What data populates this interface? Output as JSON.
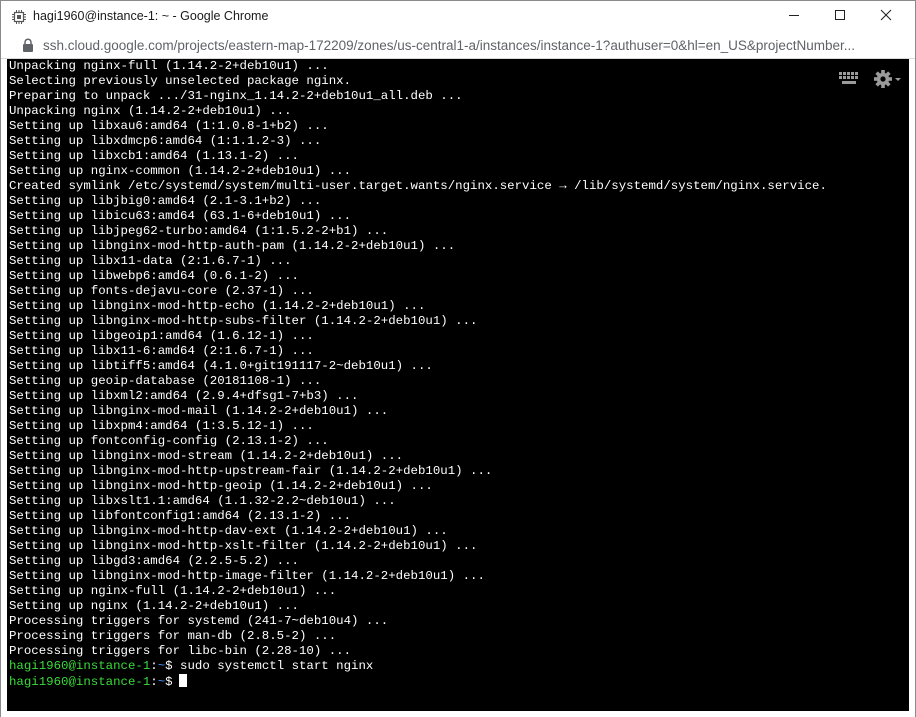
{
  "window": {
    "title": "hagi1960@instance-1: ~ - Google Chrome",
    "controls": {
      "minimize": "minimize",
      "maximize": "maximize",
      "close": "close"
    }
  },
  "address": {
    "url_host": "ssh.cloud.google.com",
    "url_rest": "/projects/eastern-map-172209/zones/us-central1-a/instances/instance-1?authuser=0&hl=en_US&projectNumber..."
  },
  "terminal": {
    "toolbar_icons": [
      "keyboard-icon",
      "gear-icon"
    ],
    "lines": [
      "Unpacking nginx-full (1.14.2-2+deb10u1) ...",
      "Selecting previously unselected package nginx.",
      "Preparing to unpack .../31-nginx_1.14.2-2+deb10u1_all.deb ...",
      "Unpacking nginx (1.14.2-2+deb10u1) ...",
      "Setting up libxau6:amd64 (1:1.0.8-1+b2) ...",
      "Setting up libxdmcp6:amd64 (1:1.1.2-3) ...",
      "Setting up libxcb1:amd64 (1.13.1-2) ...",
      "Setting up nginx-common (1.14.2-2+deb10u1) ...",
      "Created symlink /etc/systemd/system/multi-user.target.wants/nginx.service → /lib/systemd/system/nginx.service.",
      "Setting up libjbig0:amd64 (2.1-3.1+b2) ...",
      "Setting up libicu63:amd64 (63.1-6+deb10u1) ...",
      "Setting up libjpeg62-turbo:amd64 (1:1.5.2-2+b1) ...",
      "Setting up libnginx-mod-http-auth-pam (1.14.2-2+deb10u1) ...",
      "Setting up libx11-data (2:1.6.7-1) ...",
      "Setting up libwebp6:amd64 (0.6.1-2) ...",
      "Setting up fonts-dejavu-core (2.37-1) ...",
      "Setting up libnginx-mod-http-echo (1.14.2-2+deb10u1) ...",
      "Setting up libnginx-mod-http-subs-filter (1.14.2-2+deb10u1) ...",
      "Setting up libgeoip1:amd64 (1.6.12-1) ...",
      "Setting up libx11-6:amd64 (2:1.6.7-1) ...",
      "Setting up libtiff5:amd64 (4.1.0+git191117-2~deb10u1) ...",
      "Setting up geoip-database (20181108-1) ...",
      "Setting up libxml2:amd64 (2.9.4+dfsg1-7+b3) ...",
      "Setting up libnginx-mod-mail (1.14.2-2+deb10u1) ...",
      "Setting up libxpm4:amd64 (1:3.5.12-1) ...",
      "Setting up fontconfig-config (2.13.1-2) ...",
      "Setting up libnginx-mod-stream (1.14.2-2+deb10u1) ...",
      "Setting up libnginx-mod-http-upstream-fair (1.14.2-2+deb10u1) ...",
      "Setting up libnginx-mod-http-geoip (1.14.2-2+deb10u1) ...",
      "Setting up libxslt1.1:amd64 (1.1.32-2.2~deb10u1) ...",
      "Setting up libfontconfig1:amd64 (2.13.1-2) ...",
      "Setting up libnginx-mod-http-dav-ext (1.14.2-2+deb10u1) ...",
      "Setting up libnginx-mod-http-xslt-filter (1.14.2-2+deb10u1) ...",
      "Setting up libgd3:amd64 (2.2.5-5.2) ...",
      "Setting up libnginx-mod-http-image-filter (1.14.2-2+deb10u1) ...",
      "Setting up nginx-full (1.14.2-2+deb10u1) ...",
      "Setting up nginx (1.14.2-2+deb10u1) ...",
      "Processing triggers for systemd (241-7~deb10u4) ...",
      "Processing triggers for man-db (2.8.5-2) ...",
      "Processing triggers for libc-bin (2.28-10) ..."
    ],
    "prompts": [
      {
        "user": "hagi1960@instance-1",
        "sep": ":",
        "path": "~",
        "sign": "$",
        "command": " sudo systemctl start nginx"
      },
      {
        "user": "hagi1960@instance-1",
        "sep": ":",
        "path": "~",
        "sign": "$",
        "command": ""
      }
    ],
    "colors": {
      "background": "#000000",
      "text": "#ffffff",
      "prompt_user": "#3adb3a",
      "prompt_path": "#4c8df6"
    }
  }
}
